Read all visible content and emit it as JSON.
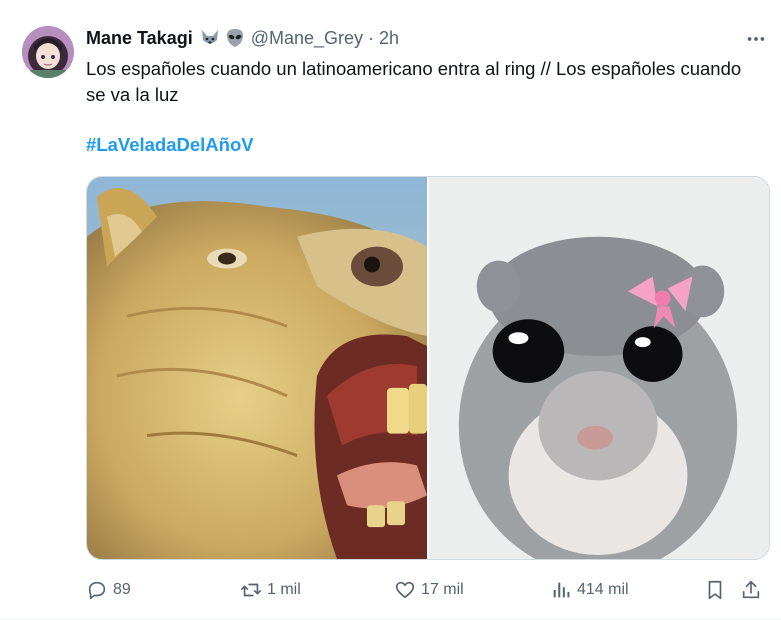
{
  "author": {
    "display_name": "Mane Takagi",
    "badges": [
      "wolf-emoji-icon",
      "alien-emoji-icon"
    ],
    "handle": "@Mane_Grey",
    "separator": "·",
    "time": "2h"
  },
  "tweet": {
    "text": "Los españoles cuando un latinoamericano entra al ring // Los españoles cuando se va la luz",
    "hashtag": "#LaVeladaDelAñoV"
  },
  "media": [
    "capybara-screaming-image",
    "sad-hamster-with-bow-image"
  ],
  "actions": {
    "replies": "89",
    "reposts": "1 mil",
    "likes": "17 mil",
    "views": "414 mil"
  },
  "colors": {
    "accent": "#1d9bf0",
    "text": "#0f1419",
    "muted": "#536471"
  }
}
